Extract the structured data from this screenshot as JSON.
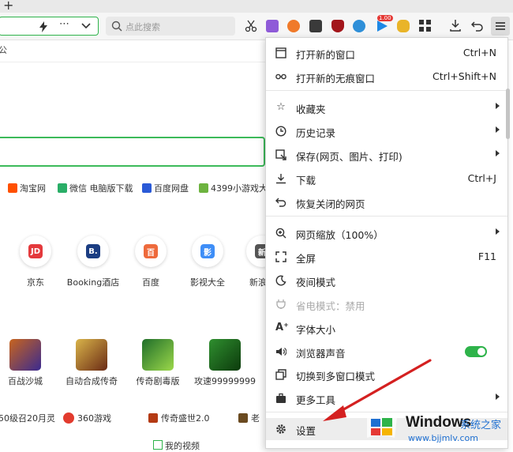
{
  "tabstrip": {
    "new_tab_symbol": "+"
  },
  "toolbar": {
    "search_placeholder": "点此搜索",
    "badge_count": "1.00"
  },
  "page": {
    "ghost_text": "公",
    "site_links": [
      "淘宝网",
      "微信 电脑版下载",
      "百度网盘",
      "4399小游戏大"
    ],
    "tiles": [
      {
        "label": "京东",
        "glyph": "JD",
        "color": "#e4393c"
      },
      {
        "label": "Booking酒店",
        "glyph": "B.",
        "color": "#1b3d82"
      },
      {
        "label": "百度",
        "glyph": "百",
        "color": "#ee6a3c"
      },
      {
        "label": "影视大全",
        "glyph": "影",
        "color": "#3e8ef7"
      },
      {
        "label": "新浪",
        "glyph": "新",
        "color": "#555555"
      }
    ],
    "games": [
      "百战沙城",
      "自动合成传奇",
      "传奇剧毒版",
      "攻速99999999"
    ],
    "bottom_links": [
      "50级召20月灵",
      "360游戏",
      "传奇盛世2.0",
      "老"
    ],
    "footer_text": "我的视频"
  },
  "menu": {
    "items": [
      {
        "icon": "window-icon",
        "label": "打开新的窗口",
        "shortcut": "Ctrl+N"
      },
      {
        "icon": "incognito-icon",
        "label": "打开新的无痕窗口",
        "shortcut": "Ctrl+Shift+N"
      },
      {
        "icon": "favorites-icon",
        "label": "收藏夹",
        "shortcut": ""
      },
      {
        "icon": "history-icon",
        "label": "历史记录",
        "shortcut": ""
      },
      {
        "icon": "save-icon",
        "label": "保存(网页、图片、打印)",
        "shortcut": ""
      },
      {
        "icon": "download-icon",
        "label": "下载",
        "shortcut": "Ctrl+J"
      },
      {
        "icon": "restore-icon",
        "label": "恢复关闭的网页",
        "shortcut": ""
      },
      {
        "icon": "zoom-icon",
        "label": "网页缩放（100%）",
        "shortcut": ""
      },
      {
        "icon": "fullscreen-icon",
        "label": "全屏",
        "shortcut": "F11"
      },
      {
        "icon": "night-mode-icon",
        "label": "夜间模式",
        "shortcut": ""
      },
      {
        "icon": "power-save-icon",
        "label": "省电模式：禁用",
        "shortcut": ""
      },
      {
        "icon": "font-size-icon",
        "label": "字体大小",
        "shortcut": ""
      },
      {
        "icon": "sound-icon",
        "label": "浏览器声音",
        "shortcut": ""
      },
      {
        "icon": "multi-window-icon",
        "label": "切换到多窗口模式",
        "shortcut": ""
      },
      {
        "icon": "tools-icon",
        "label": "更多工具",
        "shortcut": ""
      },
      {
        "icon": "gear-icon",
        "label": "设置",
        "shortcut": ""
      }
    ],
    "sound_enabled": true
  },
  "watermark": {
    "title": "Windows",
    "subtitle": "系统之家",
    "url": "www.bjjmlv.com"
  },
  "colors": {
    "accent_green": "#2eb34a",
    "arrow_red": "#d42020",
    "link_blue": "#1e6fd1"
  }
}
